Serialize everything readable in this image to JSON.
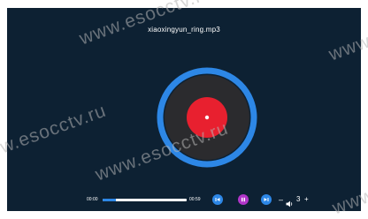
{
  "player": {
    "filename": "xiaoxingyun_ring.mp3",
    "current_time": "00:00",
    "total_time": "00:59",
    "progress_fraction": 0.16,
    "play_state": "playing",
    "volume": {
      "minus_label": "–",
      "level": "3",
      "plus_label": "+"
    }
  },
  "watermark": {
    "text_1": "www.esocctv.ru",
    "text_2": "www.esocctv.ru",
    "text_3": "www.esocctv.ru",
    "text_4": "www.esocctv.ru",
    "text_5": "www.esocctv.ru"
  },
  "colors": {
    "background": "#0d2133",
    "disc_ring": "#2d87e6",
    "disc_body": "#2b2b2e",
    "disc_label": "#e8202f",
    "prev_next_button": "#2d87e6",
    "play_pause_button": "#b135c9",
    "progress_fill": "#2d87e6"
  },
  "icons": {
    "prev": "skip-previous-icon",
    "play_pause": "pause-icon",
    "next": "skip-next-icon",
    "volume": "speaker-icon"
  }
}
